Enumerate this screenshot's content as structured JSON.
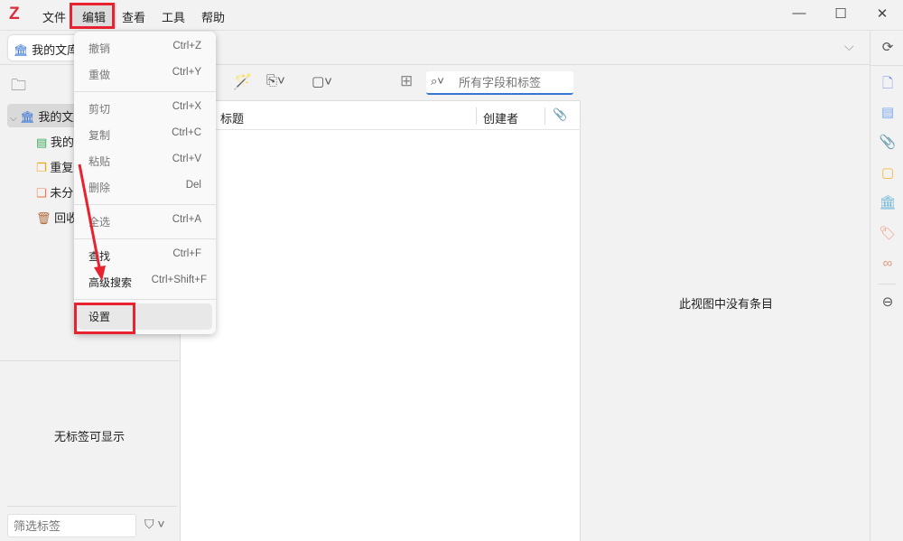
{
  "app": {
    "logo": "Z"
  },
  "menubar": [
    "文件",
    "编辑",
    "查看",
    "工具",
    "帮助"
  ],
  "window_controls": {
    "minimize": "—",
    "maximize": "☐",
    "close": "✕"
  },
  "tab": {
    "label": "我的文库"
  },
  "collections": [
    "我的文库",
    "我的出版物",
    "重复条目",
    "未分类条目",
    "回收站"
  ],
  "tags": {
    "empty": "无标签可显示",
    "filter_placeholder": "筛选标签"
  },
  "search": {
    "placeholder": "所有字段和标签"
  },
  "columns": {
    "title": "标题",
    "creator": "创建者"
  },
  "item_pane": {
    "empty": "此视图中没有条目"
  },
  "edit_menu": [
    {
      "label": "撤销",
      "shortcut": "Ctrl+Z"
    },
    {
      "label": "重做",
      "shortcut": "Ctrl+Y"
    },
    {
      "label": "剪切",
      "shortcut": "Ctrl+X"
    },
    {
      "label": "复制",
      "shortcut": "Ctrl+C"
    },
    {
      "label": "粘贴",
      "shortcut": "Ctrl+V"
    },
    {
      "label": "删除",
      "shortcut": "Del"
    },
    {
      "label": "全选",
      "shortcut": "Ctrl+A"
    },
    {
      "label": "查找",
      "shortcut": "Ctrl+F"
    },
    {
      "label": "高级搜索",
      "shortcut": "Ctrl+Shift+F"
    },
    {
      "label": "设置",
      "shortcut": ""
    }
  ],
  "colors": {
    "annotation": "#e8232f",
    "accent": "#3a75d6"
  }
}
